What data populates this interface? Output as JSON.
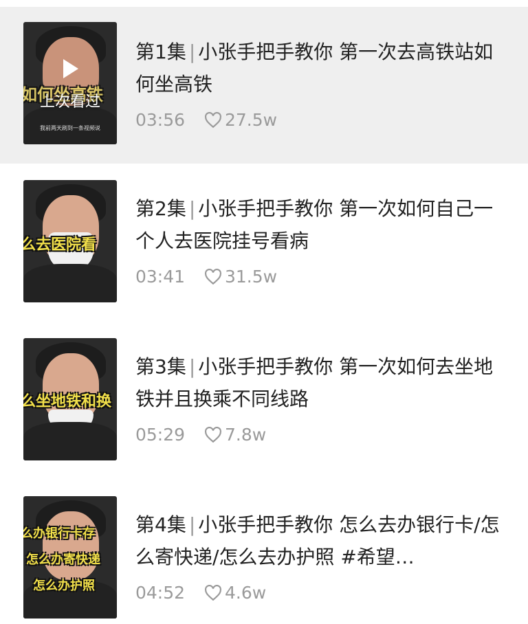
{
  "episodes": [
    {
      "episode": "第1集",
      "title": "小张手把手教你 第一次去高铁站如何坐高铁",
      "duration": "03:56",
      "likes": "27.5w",
      "thumb_caption": "如何坐高铁",
      "watched_label": "上次看过",
      "thumb_small_text": "我前两天刷到一条视频说"
    },
    {
      "episode": "第2集",
      "title": "小张手把手教你 第一次如何自己一个人去医院挂号看病",
      "duration": "03:41",
      "likes": "31.5w",
      "thumb_caption": "么去医院看"
    },
    {
      "episode": "第3集",
      "title": "小张手把手教你 第一次如何去坐地铁并且换乘不同线路",
      "duration": "05:29",
      "likes": "7.8w",
      "thumb_caption": "么坐地铁和换"
    },
    {
      "episode": "第4集",
      "title": "小张手把手教你 怎么去办银行卡/怎么寄快递/怎么去办护照 #希望…",
      "duration": "04:52",
      "likes": "4.6w",
      "thumb_captions": [
        "么办银行卡存",
        "怎么办寄快递",
        "怎么办护照"
      ]
    }
  ],
  "colors": {
    "active_row_bg": "#efefef",
    "meta_text": "#9a9a9a",
    "caption_yellow": "#f2e04a"
  },
  "icons": {
    "like": "heart-outline-icon",
    "play": "play-icon"
  }
}
